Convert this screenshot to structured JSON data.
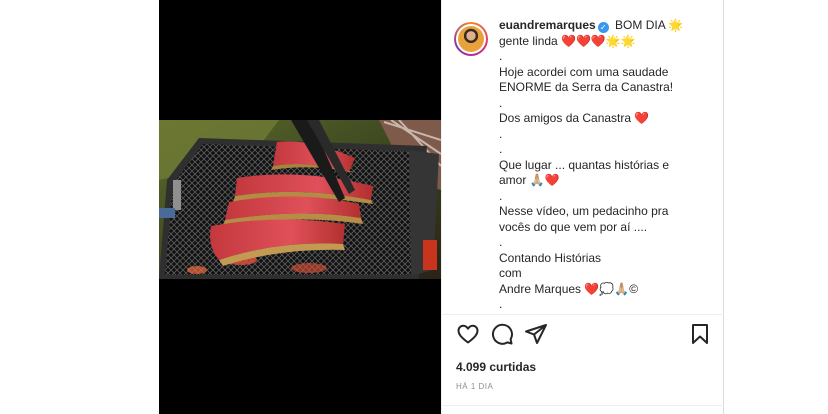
{
  "post": {
    "username": "euandremarques",
    "verified_mark": "✓",
    "caption_lines": [
      "BOM DIA 🌟",
      "gente linda ❤️❤️❤️🌟🌟",
      ".",
      "Hoje acordei com uma saudade",
      "ENORME da Serra da Canastra!",
      ".",
      "Dos amigos da Canastra ❤️",
      ".",
      ".",
      "Que lugar ... quantas histórias e",
      "amor 🙏🏼❤️",
      ".",
      "Nesse vídeo, um pedacinho pra",
      "vocês do que vem por aí ....",
      ".",
      "Contando Histórias",
      "com",
      "Andre Marques ❤️💭🙏🏼©",
      "."
    ],
    "likes": "4.099 curtidas",
    "time": "HÁ 1 DIA"
  },
  "icons": {
    "like": "heart-icon",
    "comment": "comment-icon",
    "share": "share-icon",
    "save": "bookmark-icon"
  },
  "colors": {
    "verified": "#3897f0",
    "text": "#262626",
    "muted": "#8e8e8e"
  }
}
